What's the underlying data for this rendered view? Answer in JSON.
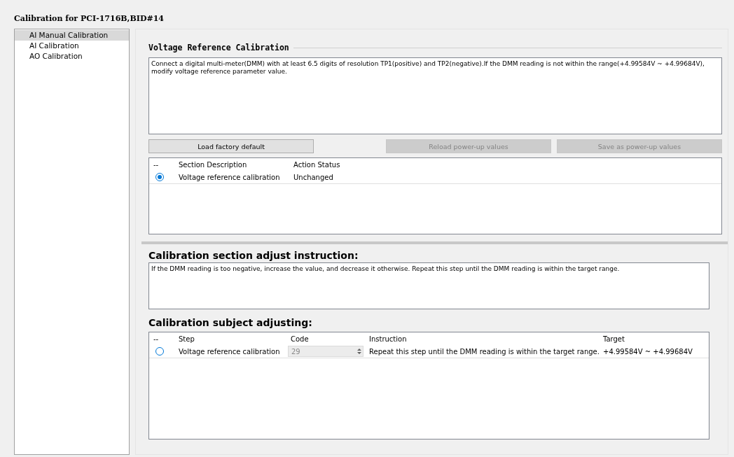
{
  "window": {
    "title": "Calibration for PCI-1716B,BID#14"
  },
  "sidebar": {
    "items": [
      {
        "label": "AI Manual Calibration",
        "selected": true
      },
      {
        "label": "AI Calibration",
        "selected": false
      },
      {
        "label": "AO Calibration",
        "selected": false
      }
    ]
  },
  "reference": {
    "title": "Voltage Reference Calibration",
    "description": "Connect a digital multi-meter(DMM) with at least 6.5 digits of resolution TP1(positive) and TP2(negative).If the DMM reading is not within the range(+4.99584V ~ +4.99684V), modify voltage reference parameter value."
  },
  "buttons": [
    {
      "label": "Load factory default",
      "disabled": false
    },
    {
      "label": "Reload power-up values",
      "disabled": true
    },
    {
      "label": "Save as power-up values",
      "disabled": true
    }
  ],
  "sections": {
    "columns": [
      "--",
      "Section Description",
      "Action Status"
    ],
    "rows": [
      {
        "selected": true,
        "description": "Voltage reference calibration",
        "status": "Unchanged"
      }
    ]
  },
  "instruction": {
    "title": "Calibration section adjust instruction:",
    "text": "If the DMM reading is too negative, increase the value, and decrease it otherwise. Repeat this step until the DMM reading is within the target range."
  },
  "adjusting": {
    "title": "Calibration subject adjusting:",
    "columns": [
      "--",
      "Step",
      "Code",
      "Instruction",
      "Target"
    ],
    "rows": [
      {
        "selected": false,
        "step": "Voltage reference calibration",
        "code": "29",
        "instruction": "Repeat this step until the DMM reading is within the target range.",
        "target": "+4.99584V ~ +4.99684V"
      }
    ]
  }
}
